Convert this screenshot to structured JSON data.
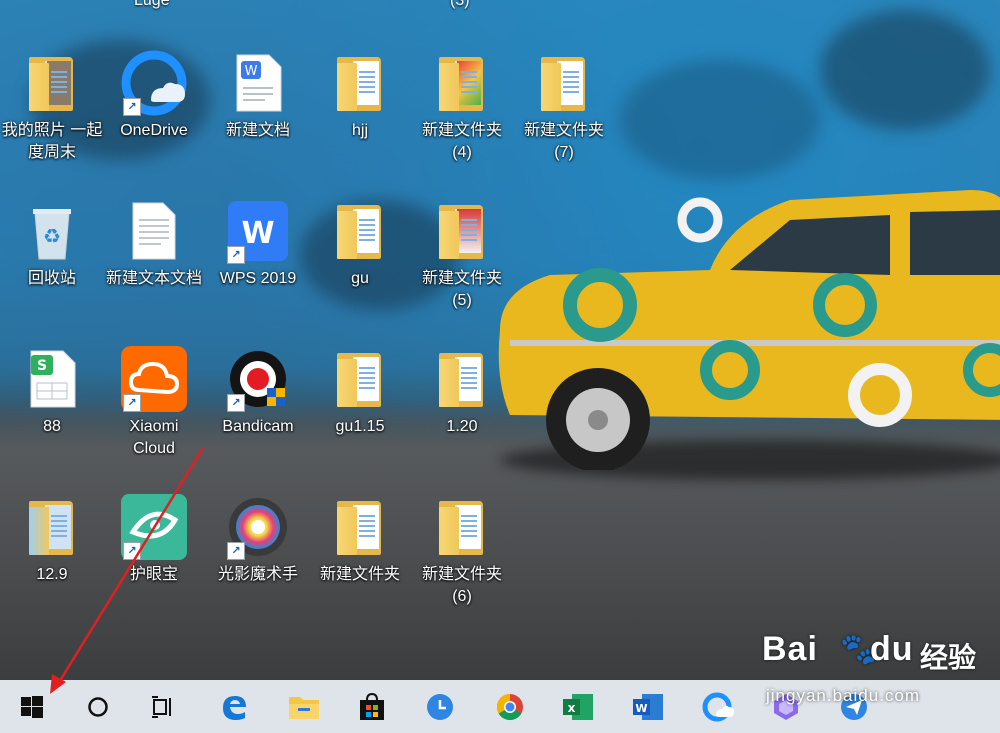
{
  "desktop": {
    "top_cut_labels": [
      "Luge",
      "(3)"
    ],
    "icons": [
      {
        "label": "我的照片 一起\n度周末",
        "type": "photo-folder"
      },
      {
        "label": "OneDrive",
        "type": "onedrive"
      },
      {
        "label": "新建文档",
        "type": "wps-doc"
      },
      {
        "label": "hjj",
        "type": "folder"
      },
      {
        "label": "新建文件夹\n(4)",
        "type": "folder-colorful"
      },
      {
        "label": "新建文件夹\n(7)",
        "type": "folder"
      },
      {
        "label": "回收站",
        "type": "recycle-bin"
      },
      {
        "label": "新建文本文档",
        "type": "text-file"
      },
      {
        "label": "WPS 2019",
        "type": "wps"
      },
      {
        "label": "gu",
        "type": "folder"
      },
      {
        "label": "新建文件夹\n(5)",
        "type": "folder-red"
      },
      {
        "label": "88",
        "type": "sheet"
      },
      {
        "label": "Xiaomi\nCloud",
        "type": "xiaomi-cloud"
      },
      {
        "label": "Bandicam",
        "type": "bandicam"
      },
      {
        "label": "gu1.15",
        "type": "folder"
      },
      {
        "label": "1.20",
        "type": "folder"
      },
      {
        "label": "12.9",
        "type": "folder-blue"
      },
      {
        "label": "护眼宝",
        "type": "eye-care"
      },
      {
        "label": "光影魔术手",
        "type": "photo-editor"
      },
      {
        "label": "新建文件夹",
        "type": "folder"
      },
      {
        "label": "新建文件夹\n(6)",
        "type": "folder"
      }
    ]
  },
  "taskbar": {
    "items": [
      {
        "name": "start-button",
        "icon": "windows-logo-icon"
      },
      {
        "name": "cortana-search-button",
        "icon": "circle-icon"
      },
      {
        "name": "task-view-button",
        "icon": "task-view-icon"
      },
      {
        "name": "edge-button",
        "icon": "edge-icon"
      },
      {
        "name": "file-explorer-button",
        "icon": "folder-icon"
      },
      {
        "name": "store-button",
        "icon": "store-bag-icon"
      },
      {
        "name": "clock-app-button",
        "icon": "clock-icon"
      },
      {
        "name": "chrome-button",
        "icon": "chrome-icon"
      },
      {
        "name": "excel-button",
        "icon": "excel-icon"
      },
      {
        "name": "word-button",
        "icon": "word-icon"
      },
      {
        "name": "onedrive-button",
        "icon": "onedrive-icon"
      },
      {
        "name": "app-purple-button",
        "icon": "purple-app-icon"
      },
      {
        "name": "feishu-button",
        "icon": "paper-plane-icon"
      }
    ]
  },
  "watermark": {
    "brand": "Bai",
    "brand_suffix": "du",
    "cn": "经验",
    "url": "jingyan.baidu.com"
  },
  "colors": {
    "taskbar": "#dfe4ea",
    "arrow": "#e02020",
    "folder": "#f0c75a"
  }
}
